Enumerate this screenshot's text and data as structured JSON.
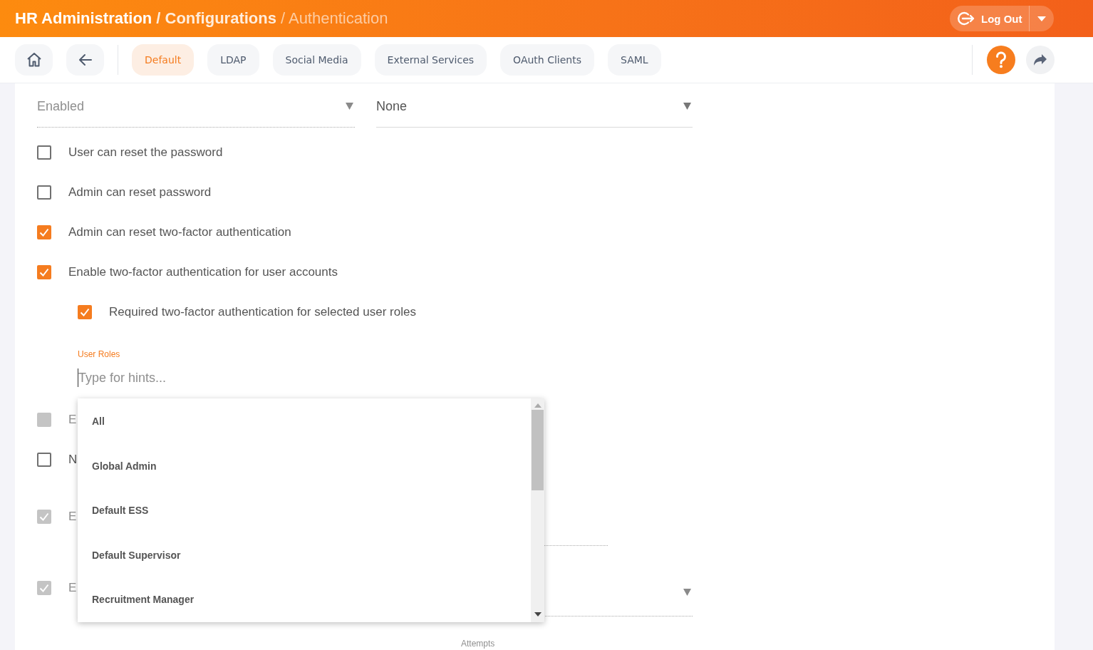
{
  "header": {
    "breadcrumbs": [
      {
        "label": "HR Administration",
        "kind": "root"
      },
      {
        "label": "/ Configurations",
        "kind": "parent"
      },
      {
        "label": "/ Authentication",
        "kind": "current"
      }
    ],
    "logout_button": {
      "label": "Log Out"
    }
  },
  "toolbar": {
    "tabs": [
      {
        "label": "Default",
        "selected": true
      },
      {
        "label": "LDAP",
        "selected": false
      },
      {
        "label": "Social Media",
        "selected": false
      },
      {
        "label": "External Services",
        "selected": false
      },
      {
        "label": "OAuth Clients",
        "selected": false
      },
      {
        "label": "SAML",
        "selected": false
      }
    ]
  },
  "form": {
    "fields": [
      {
        "value": "Enabled",
        "disabled": true
      },
      {
        "value": "None",
        "disabled": false
      }
    ],
    "options": [
      {
        "kind": "checkbox",
        "label": "User can reset the password",
        "checked": false,
        "disabled": false
      },
      {
        "kind": "checkbox",
        "label": "Admin can reset password",
        "checked": false,
        "disabled": false
      },
      {
        "kind": "checkbox",
        "label": "Admin can reset two-factor authentication",
        "checked": true,
        "disabled": false
      },
      {
        "kind": "checkbox",
        "label": "Enable two-factor authentication for user accounts",
        "checked": true,
        "disabled": false,
        "children": [
          {
            "kind": "checkbox",
            "label": "Required two-factor authentication for selected user roles",
            "checked": true,
            "disabled": false
          },
          {
            "kind": "tag_input",
            "label": "User Roles",
            "placeholder": "Type for hints..."
          }
        ]
      },
      {
        "kind": "checkbox",
        "label": "E",
        "checked": false,
        "disabled": true
      },
      {
        "kind": "checkbox",
        "label": "N",
        "checked": false,
        "disabled": false
      },
      {
        "kind": "checkbox",
        "label": "E",
        "checked": true,
        "disabled": true,
        "side_field": {
          "kind": "input"
        }
      },
      {
        "kind": "checkbox",
        "label": "E",
        "checked": true,
        "disabled": true,
        "side_field": {
          "kind": "select"
        }
      },
      {
        "kind": "field_label",
        "label": "Attempts"
      }
    ]
  },
  "role_suggestions": {
    "items": [
      {
        "label": "All"
      },
      {
        "label": "Global Admin"
      },
      {
        "label": "Default ESS"
      },
      {
        "label": "Default Supervisor"
      },
      {
        "label": "Recruitment Manager"
      }
    ]
  }
}
